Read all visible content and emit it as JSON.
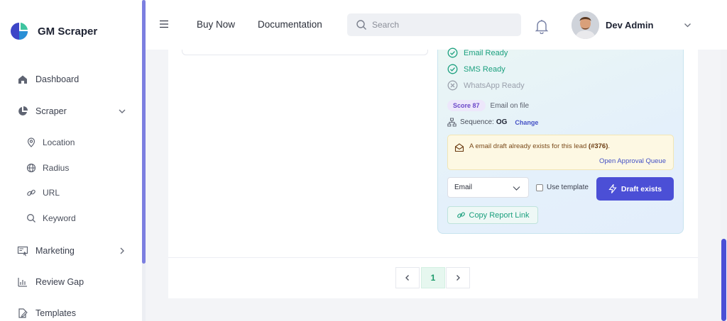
{
  "brand": {
    "name": "GM Scraper"
  },
  "sidebar": {
    "items": [
      {
        "label": "Dashboard",
        "icon": "home-icon"
      },
      {
        "label": "Scraper",
        "icon": "pie-chart-icon"
      },
      {
        "label": "Marketing",
        "icon": "campaign-icon"
      },
      {
        "label": "Review Gap",
        "icon": "bar-chart-icon"
      },
      {
        "label": "Templates",
        "icon": "edit-document-icon"
      }
    ],
    "scraper_sub": [
      {
        "label": "Location",
        "icon": "map-pin-icon"
      },
      {
        "label": "Radius",
        "icon": "globe-icon"
      },
      {
        "label": "URL",
        "icon": "link-icon"
      },
      {
        "label": "Keyword",
        "icon": "search-icon"
      }
    ]
  },
  "header": {
    "links": [
      "Buy Now",
      "Documentation"
    ],
    "search_placeholder": "Search",
    "user_name": "Dev Admin"
  },
  "lead": {
    "channels": [
      {
        "label": "Email Ready",
        "status": "ready"
      },
      {
        "label": "SMS Ready",
        "status": "ready"
      },
      {
        "label": "WhatsApp Ready",
        "status": "not-ready"
      }
    ],
    "score_badge": "Score 87",
    "score_note": "Email on file",
    "sequence_label": "Sequence:",
    "sequence_value": "OG",
    "sequence_change": "Change",
    "alert_text": "A email draft already exists for this lead",
    "alert_ref": "(#376)",
    "alert_end": ".",
    "alert_link": "Open Approval Queue",
    "channel_select": "Email",
    "use_template_label": "Use template",
    "draft_button": "Draft exists",
    "copy_button": "Copy Report Link"
  },
  "pagination": {
    "current": "1"
  },
  "colors": {
    "accent": "#4b4fd6",
    "success": "#1ba07e",
    "muted": "#9aa0ac"
  }
}
